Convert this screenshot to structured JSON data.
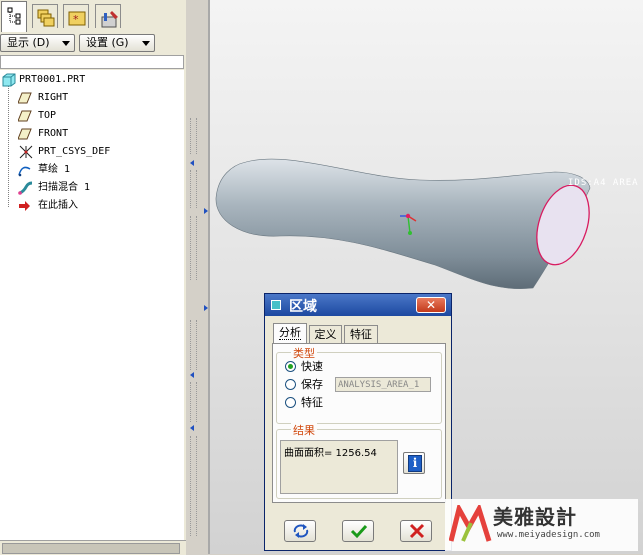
{
  "left_panel": {
    "tabs": [
      {
        "icon": "model-tree-icon"
      },
      {
        "icon": "layers-icon"
      },
      {
        "icon": "favorites-folder-icon"
      },
      {
        "icon": "tools-icon"
      }
    ],
    "buttons": {
      "display": "显示 (D)",
      "settings": "设置 (G)"
    },
    "tree": [
      {
        "label": "PRT0001.PRT",
        "icon": "part-icon"
      },
      {
        "label": "RIGHT",
        "icon": "datum-plane-icon"
      },
      {
        "label": "TOP",
        "icon": "datum-plane-icon"
      },
      {
        "label": "FRONT",
        "icon": "datum-plane-icon"
      },
      {
        "label": "PRT_CSYS_DEF",
        "icon": "csys-icon"
      },
      {
        "label": "草绘 1",
        "icon": "sketch-icon"
      },
      {
        "label": "扫描混合 1",
        "icon": "sweep-blend-icon"
      },
      {
        "label": "在此插入",
        "icon": "insert-here-arrow-icon"
      }
    ]
  },
  "graphics": {
    "datum_tag": "IDS:A4 AREA"
  },
  "dialog": {
    "title": "区域",
    "close_label": "✕",
    "tabs": [
      "分析",
      "定义",
      "特征"
    ],
    "type_group": {
      "title": "类型",
      "options": [
        {
          "label": "快速",
          "selected": true
        },
        {
          "label": "保存",
          "selected": false
        },
        {
          "label": "特征",
          "selected": false
        }
      ],
      "name_value": "ANALYSIS_AREA_1"
    },
    "result_group": {
      "title": "结果",
      "text": "曲面面积= 1256.54",
      "info_icon": "info-icon",
      "info_label": "i"
    },
    "actions": [
      {
        "name": "repeat-button",
        "icon": "repeat-arrows-icon"
      },
      {
        "name": "ok-button",
        "icon": "checkmark-icon"
      },
      {
        "name": "cancel-button",
        "icon": "red-x-icon"
      }
    ]
  },
  "watermark": {
    "text": "美雅設計",
    "url": "www.meiyadesign.com"
  },
  "colors": {
    "title_blue": "#1d49a0",
    "group_title_orange": "#d1490e",
    "cap_magenta": "#d81b60",
    "tube_gray": "#8a9aa6"
  }
}
